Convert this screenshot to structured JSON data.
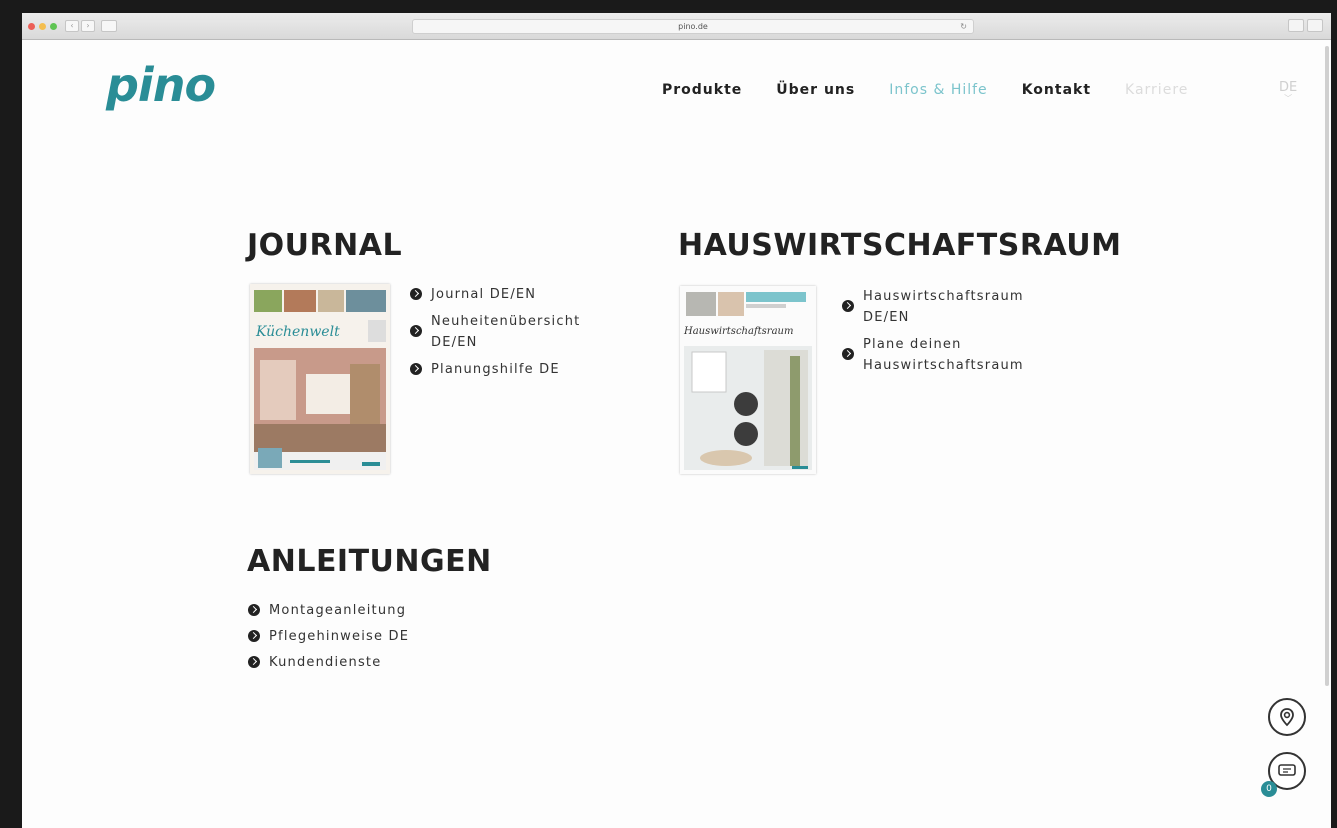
{
  "browser": {
    "url": "pino.de"
  },
  "site": {
    "logo": "pino"
  },
  "nav": {
    "items": [
      {
        "label": "Produkte"
      },
      {
        "label": "Über uns"
      },
      {
        "label": "Infos & Hilfe"
      },
      {
        "label": "Kontakt"
      },
      {
        "label": "Karriere"
      }
    ],
    "language": "DE"
  },
  "journal": {
    "title": "JOURNAL",
    "cover_title": "Küchenwelt",
    "links": [
      {
        "label": "Journal DE/EN"
      },
      {
        "label": "Neuheitenübersicht DE/EN"
      },
      {
        "label": "Planungshilfe DE"
      }
    ]
  },
  "hauswirtschaftsraum": {
    "title": "HAUSWIRTSCHAFTSRAUM",
    "cover_title": "Hauswirtschaftsraum",
    "links": [
      {
        "label": "Hauswirtschaftsraum DE/EN"
      },
      {
        "label": "Plane deinen Hauswirtschaftsraum"
      }
    ]
  },
  "anleitungen": {
    "title": "ANLEITUNGEN",
    "links": [
      {
        "label": "Montageanleitung"
      },
      {
        "label": "Pflegehinweise DE"
      },
      {
        "label": "Kundendienste"
      }
    ]
  },
  "floating": {
    "chat_badge": "0"
  },
  "colors": {
    "brand": "#2a8d96",
    "active_nav": "#7cc4cc",
    "text": "#222222"
  }
}
